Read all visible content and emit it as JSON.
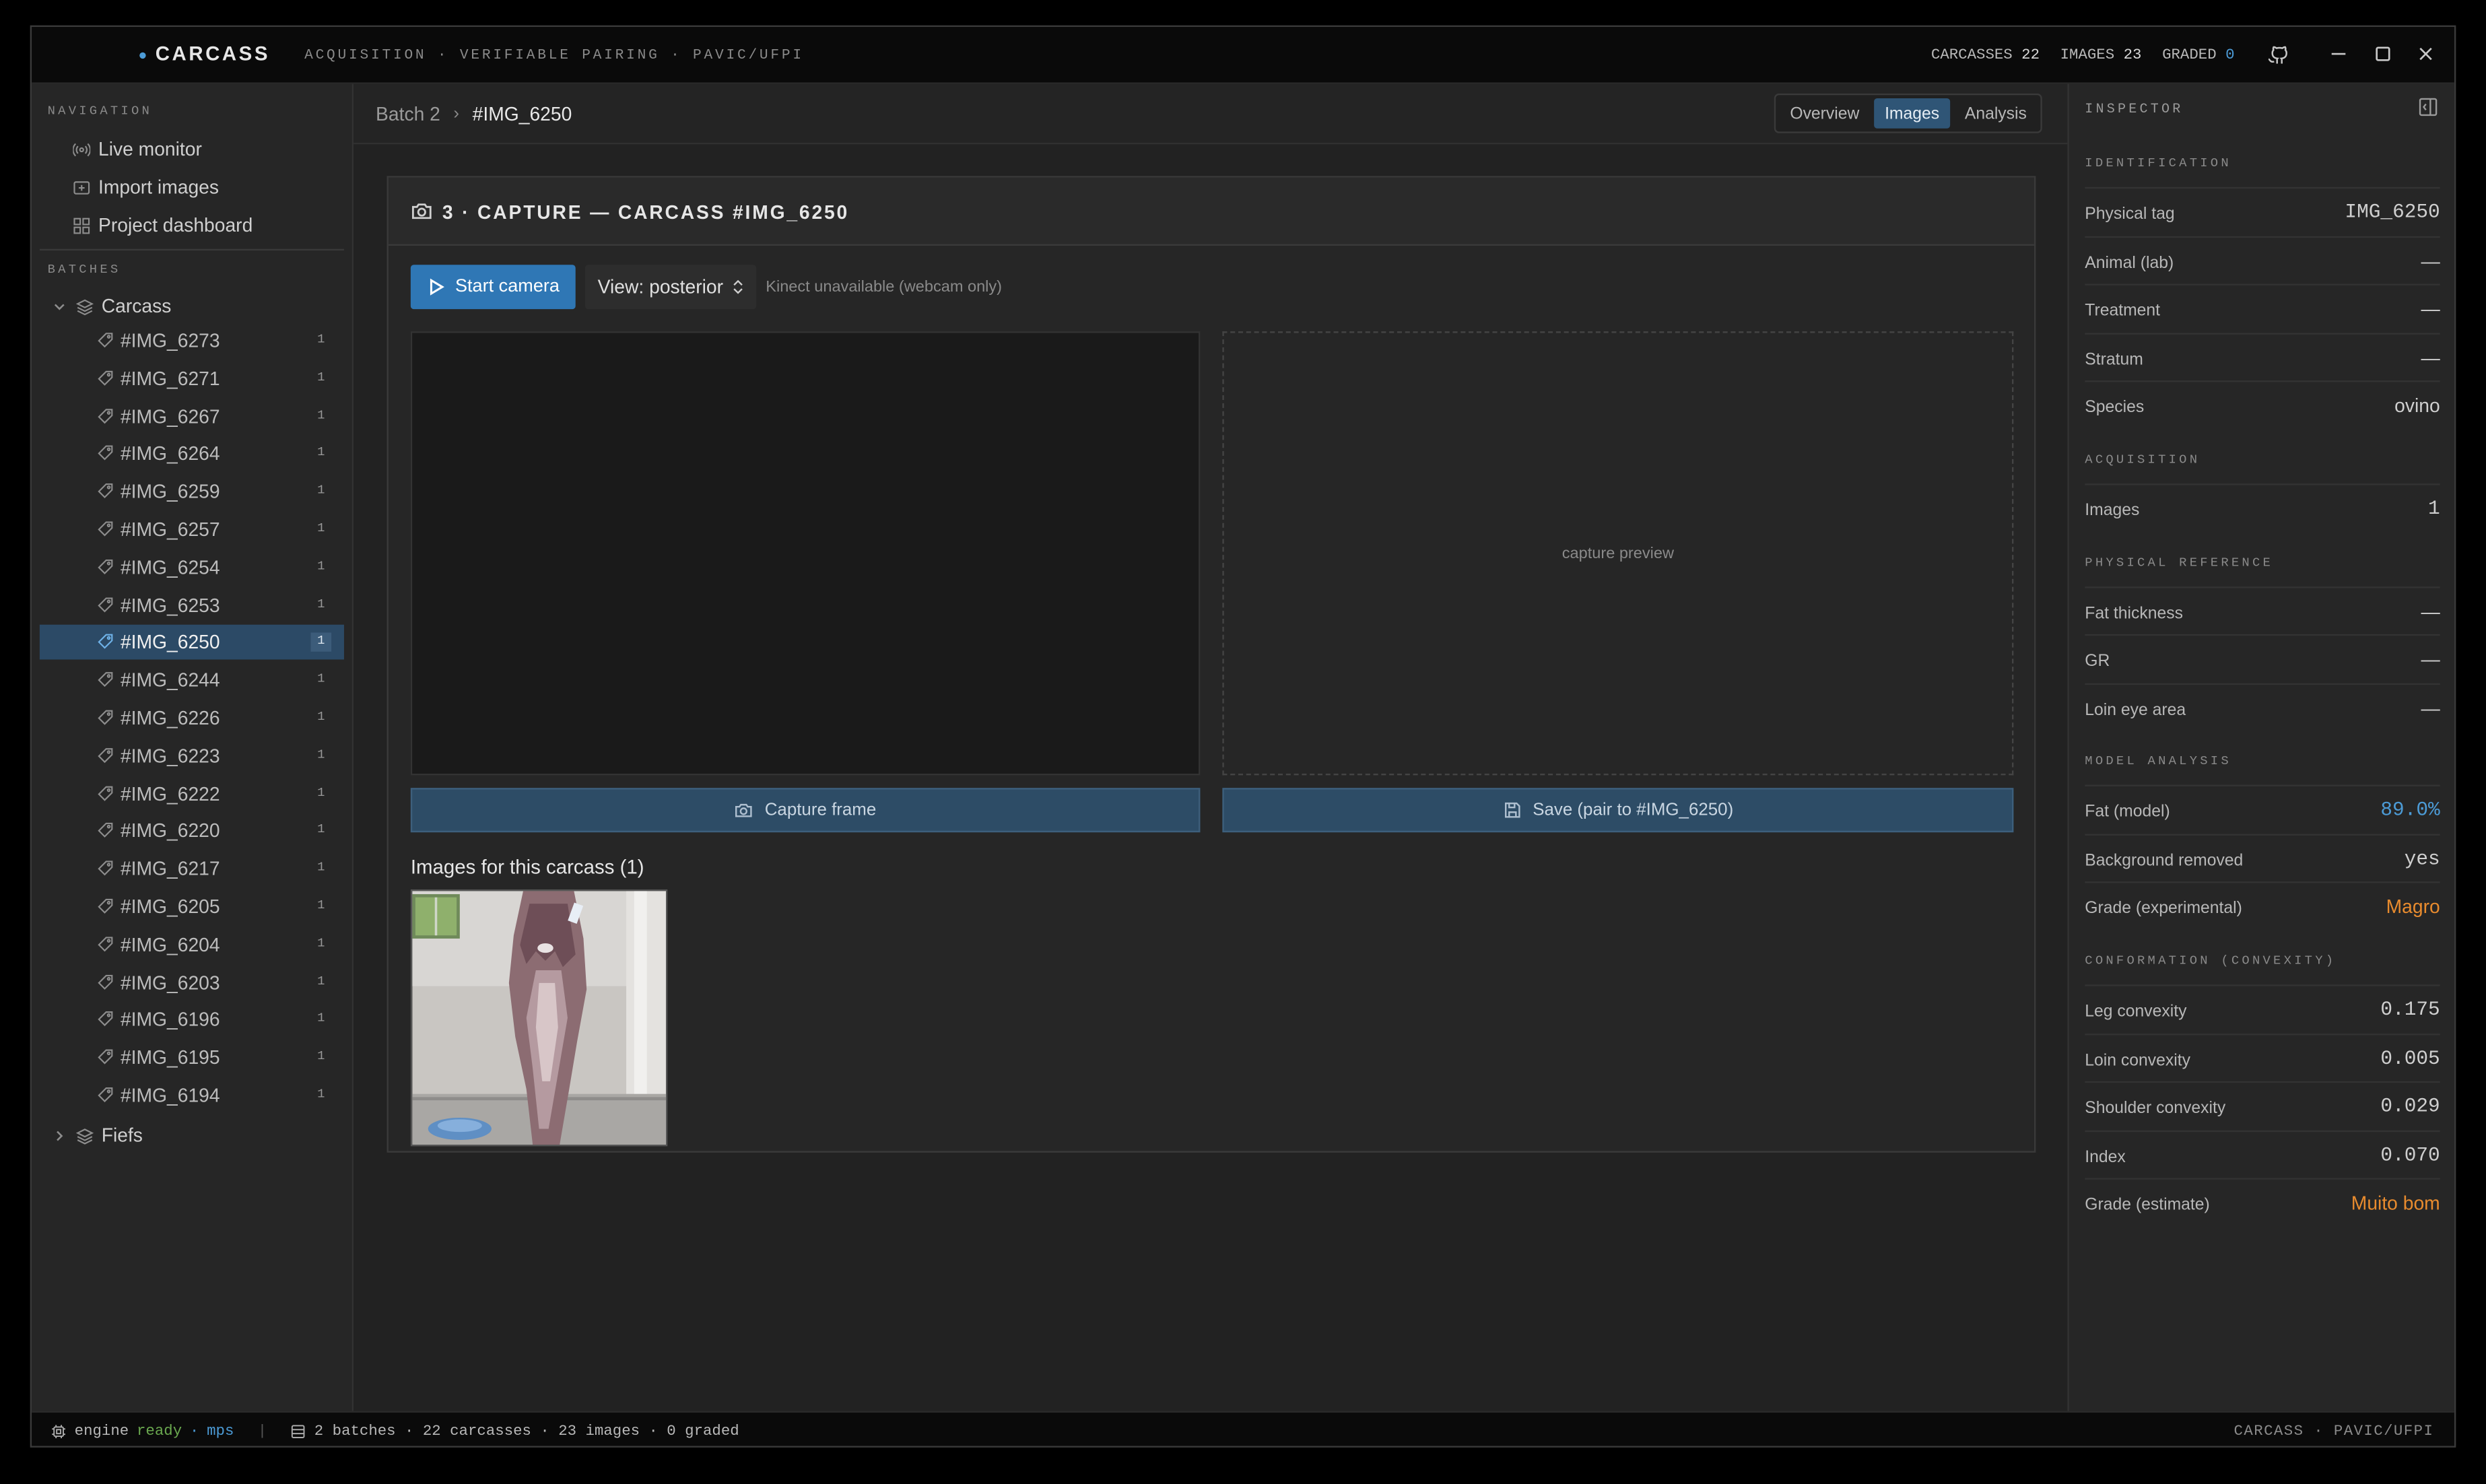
{
  "titlebar": {
    "brand": "CARCASS",
    "subtitle": "ACQUISITION · VERIFIABLE PAIRING · PAVIC/UFPI",
    "carcasses_label": "CARCASSES",
    "carcasses_value": "22",
    "images_label": "IMAGES",
    "images_value": "23",
    "graded_label": "GRADED",
    "graded_value": "0"
  },
  "sidebar": {
    "nav_title": "NAVIGATION",
    "nav_items": [
      {
        "label": "Live monitor",
        "icon": "radio-waves-icon"
      },
      {
        "label": "Import images",
        "icon": "import-icon"
      },
      {
        "label": "Project dashboard",
        "icon": "grid-icon"
      }
    ],
    "batches_title": "BATCHES",
    "batches": [
      {
        "label": "Carcass",
        "expanded": true
      },
      {
        "label": "Fiefs",
        "expanded": false
      }
    ],
    "selected": "#IMG_6250",
    "carcass_items": [
      {
        "label": "#IMG_6273",
        "count": "1"
      },
      {
        "label": "#IMG_6271",
        "count": "1"
      },
      {
        "label": "#IMG_6267",
        "count": "1"
      },
      {
        "label": "#IMG_6264",
        "count": "1"
      },
      {
        "label": "#IMG_6259",
        "count": "1"
      },
      {
        "label": "#IMG_6257",
        "count": "1"
      },
      {
        "label": "#IMG_6254",
        "count": "1"
      },
      {
        "label": "#IMG_6253",
        "count": "1"
      },
      {
        "label": "#IMG_6250",
        "count": "1"
      },
      {
        "label": "#IMG_6244",
        "count": "1"
      },
      {
        "label": "#IMG_6226",
        "count": "1"
      },
      {
        "label": "#IMG_6223",
        "count": "1"
      },
      {
        "label": "#IMG_6222",
        "count": "1"
      },
      {
        "label": "#IMG_6220",
        "count": "1"
      },
      {
        "label": "#IMG_6217",
        "count": "1"
      },
      {
        "label": "#IMG_6205",
        "count": "1"
      },
      {
        "label": "#IMG_6204",
        "count": "1"
      },
      {
        "label": "#IMG_6203",
        "count": "1"
      },
      {
        "label": "#IMG_6196",
        "count": "1"
      },
      {
        "label": "#IMG_6195",
        "count": "1"
      },
      {
        "label": "#IMG_6194",
        "count": "1"
      }
    ]
  },
  "breadcrumb": {
    "parent": "Batch 2",
    "separator": "›",
    "current": "#IMG_6250"
  },
  "tabs": [
    {
      "label": "Overview",
      "active": false
    },
    {
      "label": "Images",
      "active": true
    },
    {
      "label": "Analysis",
      "active": false
    }
  ],
  "capture": {
    "title": "3 · CAPTURE — CARCASS #IMG_6250",
    "start_button": "Start camera",
    "view_select": "View: posterior",
    "kinect_note": "Kinect unavailable (webcam only)",
    "preview_placeholder": "capture preview",
    "capture_button": "Capture frame",
    "save_button": "Save (pair to #IMG_6250)",
    "images_heading": "Images for this carcass (1)"
  },
  "inspector": {
    "title": "INSPECTOR",
    "sections": [
      {
        "title": "IDENTIFICATION",
        "rows": [
          {
            "key": "Physical tag",
            "value": "IMG_6250",
            "mono": true
          },
          {
            "key": "Animal (lab)",
            "value": "—"
          },
          {
            "key": "Treatment",
            "value": "—"
          },
          {
            "key": "Stratum",
            "value": "—"
          },
          {
            "key": "Species",
            "value": "ovino"
          }
        ]
      },
      {
        "title": "ACQUISITION",
        "rows": [
          {
            "key": "Images",
            "value": "1",
            "mono": true
          }
        ]
      },
      {
        "title": "PHYSICAL REFERENCE",
        "rows": [
          {
            "key": "Fat thickness",
            "value": "—"
          },
          {
            "key": "GR",
            "value": "—"
          },
          {
            "key": "Loin eye area",
            "value": "—"
          }
        ]
      },
      {
        "title": "MODEL ANALYSIS",
        "rows": [
          {
            "key": "Fat (model)",
            "value": "89.0%",
            "mono": true,
            "color": "blue"
          },
          {
            "key": "Background removed",
            "value": "yes",
            "mono": true
          },
          {
            "key": "Grade (experimental)",
            "value": "Magro",
            "color": "orange"
          }
        ]
      },
      {
        "title": "CONFORMATION (CONVEXITY)",
        "rows": [
          {
            "key": "Leg convexity",
            "value": "0.175",
            "mono": true
          },
          {
            "key": "Loin convexity",
            "value": "0.005",
            "mono": true
          },
          {
            "key": "Shoulder convexity",
            "value": "0.029",
            "mono": true
          },
          {
            "key": "Index",
            "value": "0.070",
            "mono": true
          },
          {
            "key": "Grade (estimate)",
            "value": "Muito bom",
            "color": "orange"
          }
        ]
      }
    ]
  },
  "statusbar": {
    "engine_label": "engine",
    "engine_state": "ready",
    "engine_sep": "·",
    "engine_device": "mps",
    "summary": "2 batches · 22 carcasses · 23 images · 0 graded",
    "right": "CARCASS · PAVIC/UFPI"
  },
  "colors": {
    "accent": "#4c9bd6",
    "primary_button": "#2f77b5",
    "selected_row": "#2c4a66",
    "warning": "#e88b2e",
    "ready": "#6aa84f"
  }
}
